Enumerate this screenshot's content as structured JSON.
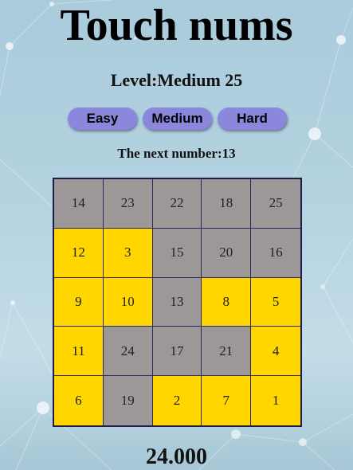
{
  "title": "Touch nums",
  "level_text": "Level:Medium 25",
  "buttons": {
    "easy": "Easy",
    "medium": "Medium",
    "hard": "Hard"
  },
  "next_text": "The next number:13",
  "next_number": 13,
  "grid": [
    {
      "num": "14",
      "state": "gray"
    },
    {
      "num": "23",
      "state": "gray"
    },
    {
      "num": "22",
      "state": "gray"
    },
    {
      "num": "18",
      "state": "gray"
    },
    {
      "num": "25",
      "state": "gray"
    },
    {
      "num": "12",
      "state": "yellow"
    },
    {
      "num": "3",
      "state": "yellow"
    },
    {
      "num": "15",
      "state": "gray"
    },
    {
      "num": "20",
      "state": "gray"
    },
    {
      "num": "16",
      "state": "gray"
    },
    {
      "num": "9",
      "state": "yellow"
    },
    {
      "num": "10",
      "state": "yellow"
    },
    {
      "num": "13",
      "state": "gray"
    },
    {
      "num": "8",
      "state": "yellow"
    },
    {
      "num": "5",
      "state": "yellow"
    },
    {
      "num": "11",
      "state": "yellow"
    },
    {
      "num": "24",
      "state": "gray"
    },
    {
      "num": "17",
      "state": "gray"
    },
    {
      "num": "21",
      "state": "gray"
    },
    {
      "num": "4",
      "state": "yellow"
    },
    {
      "num": "6",
      "state": "yellow"
    },
    {
      "num": "19",
      "state": "gray"
    },
    {
      "num": "2",
      "state": "yellow"
    },
    {
      "num": "7",
      "state": "yellow"
    },
    {
      "num": "1",
      "state": "yellow"
    }
  ],
  "timer": "24.000",
  "colors": {
    "button": "#8a87dd",
    "touched": "#ffd600",
    "untouched": "#9d9898",
    "grid_border": "#1f1b4a"
  }
}
